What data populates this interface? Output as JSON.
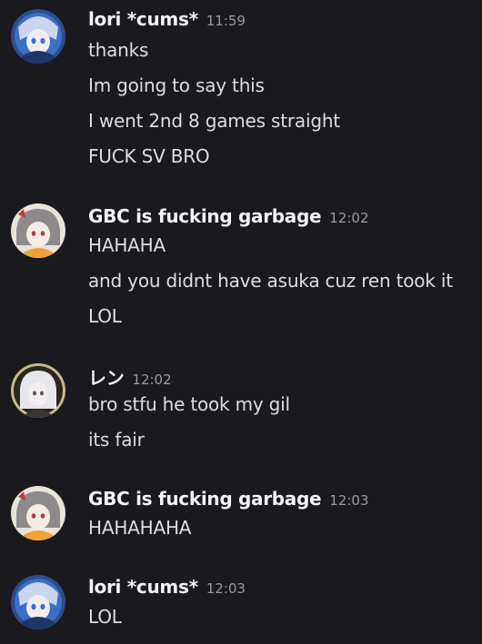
{
  "messages": [
    {
      "author": "lori *cums*",
      "time": "11:59",
      "lines": [
        "thanks",
        "Im going to say this",
        "I went 2nd 8 games straight",
        "FUCK SV BRO"
      ]
    },
    {
      "author": "GBC is fucking garbage",
      "time": "12:02",
      "lines": [
        "HAHAHA",
        "and you didnt have asuka cuz ren took it",
        "LOL"
      ]
    },
    {
      "author": "レン",
      "time": "12:02",
      "lines": [
        "bro stfu he took my gil",
        "its fair"
      ]
    },
    {
      "author": "GBC is fucking garbage",
      "time": "12:03",
      "lines": [
        "HAHAHAHA"
      ]
    },
    {
      "author": "lori *cums*",
      "time": "12:03",
      "lines": [
        "LOL"
      ]
    }
  ]
}
